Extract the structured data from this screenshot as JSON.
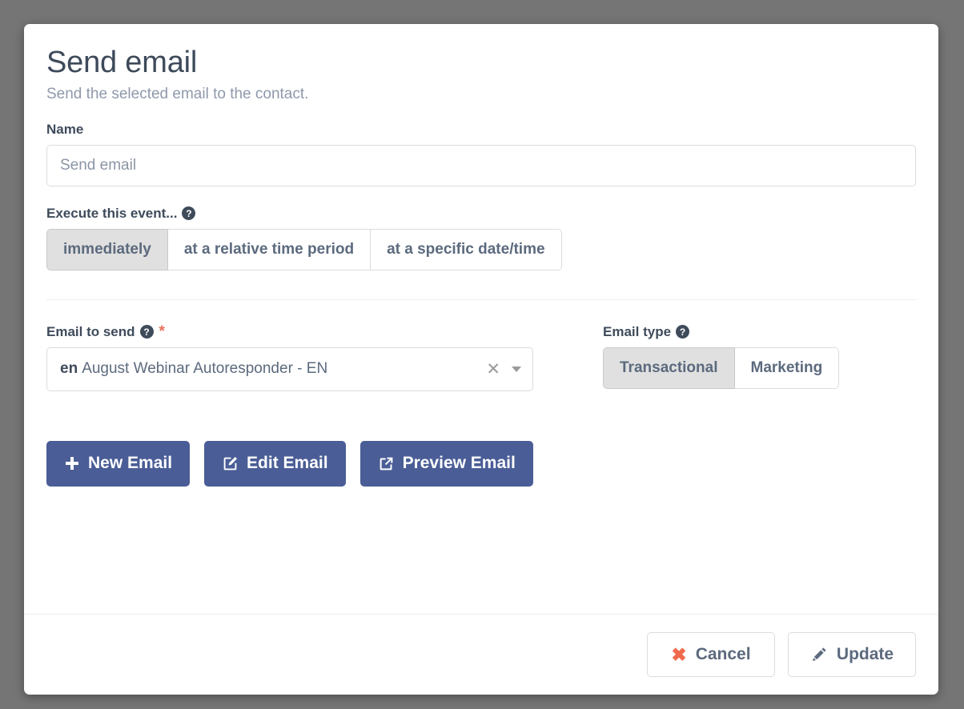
{
  "modal": {
    "title": "Send email",
    "subtitle": "Send the selected email to the contact."
  },
  "name_field": {
    "label": "Name",
    "value": "Send email",
    "placeholder": "Send email"
  },
  "execute": {
    "label": "Execute this event...",
    "help_icon": "help-circle-icon",
    "options": [
      {
        "label": "immediately",
        "active": true
      },
      {
        "label": "at a relative time period",
        "active": false
      },
      {
        "label": "at a specific date/time",
        "active": false
      }
    ]
  },
  "email_to_send": {
    "label": "Email to send",
    "help_icon": "help-circle-icon",
    "required_marker": "*",
    "selected_lang": "en",
    "selected_value": "August Webinar Autoresponder - EN",
    "clear_icon": "clear-x-icon",
    "caret_icon": "chevron-down-icon"
  },
  "email_type": {
    "label": "Email type",
    "help_icon": "help-circle-icon",
    "options": [
      {
        "label": "Transactional",
        "active": true
      },
      {
        "label": "Marketing",
        "active": false
      }
    ]
  },
  "actions": [
    {
      "label": "New Email",
      "icon": "plus-icon"
    },
    {
      "label": "Edit Email",
      "icon": "pencil-square-icon"
    },
    {
      "label": "Preview Email",
      "icon": "external-link-icon"
    }
  ],
  "footer": {
    "cancel_label": "Cancel",
    "cancel_icon": "x-mark-icon",
    "update_label": "Update",
    "update_icon": "pencil-icon"
  },
  "colors": {
    "primary_button": "#4a5d96",
    "overlay": "#757575",
    "title_text": "#3e4a5a",
    "subtitle_text": "#8f99ab",
    "danger": "#ef6a4c",
    "required_star": "#e8705a",
    "segment_active_bg": "#e0e0e0"
  }
}
